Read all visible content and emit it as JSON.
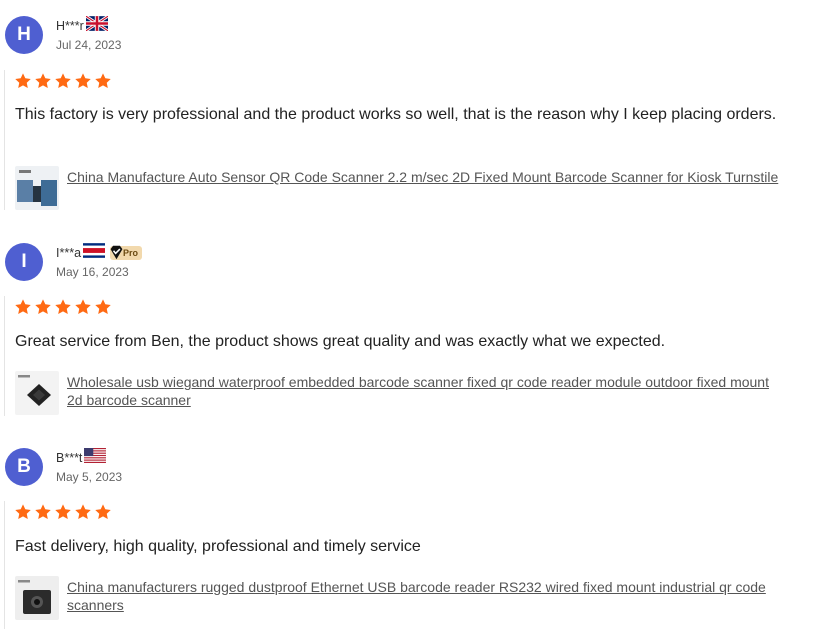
{
  "reviews": [
    {
      "initial": "H",
      "name": "H***r",
      "flag": "uk-flag-icon",
      "date": "Jul 24, 2023",
      "rating": 5,
      "text": "This factory is very professional and the product works so well, that is the reason why I keep placing orders.",
      "product": "China Manufacture Auto Sensor QR Code Scanner 2.2 m/sec 2D Fixed Mount Barcode Scanner for Kiosk Turnstile"
    },
    {
      "initial": "I",
      "name": "I***a",
      "flag": "costa-rica-flag-icon",
      "badge": "Pro",
      "date": "May 16, 2023",
      "rating": 5,
      "text": "Great service from Ben, the product shows great quality and was exactly what we expected.",
      "product": "Wholesale usb wiegand waterproof embedded barcode scanner fixed qr code reader module outdoor fixed mount 2d barcode scanner"
    },
    {
      "initial": "B",
      "name": "B***t",
      "flag": "us-flag-icon",
      "date": "May 5, 2023",
      "rating": 5,
      "text": "Fast delivery, high quality, professional and timely service",
      "product": "China manufacturers rugged dustproof Ethernet USB barcode reader RS232 wired fixed mount industrial qr code scanners"
    }
  ],
  "colors": {
    "avatar": "#4f5fd1",
    "star": "#ff6a13",
    "link": "#555555"
  }
}
